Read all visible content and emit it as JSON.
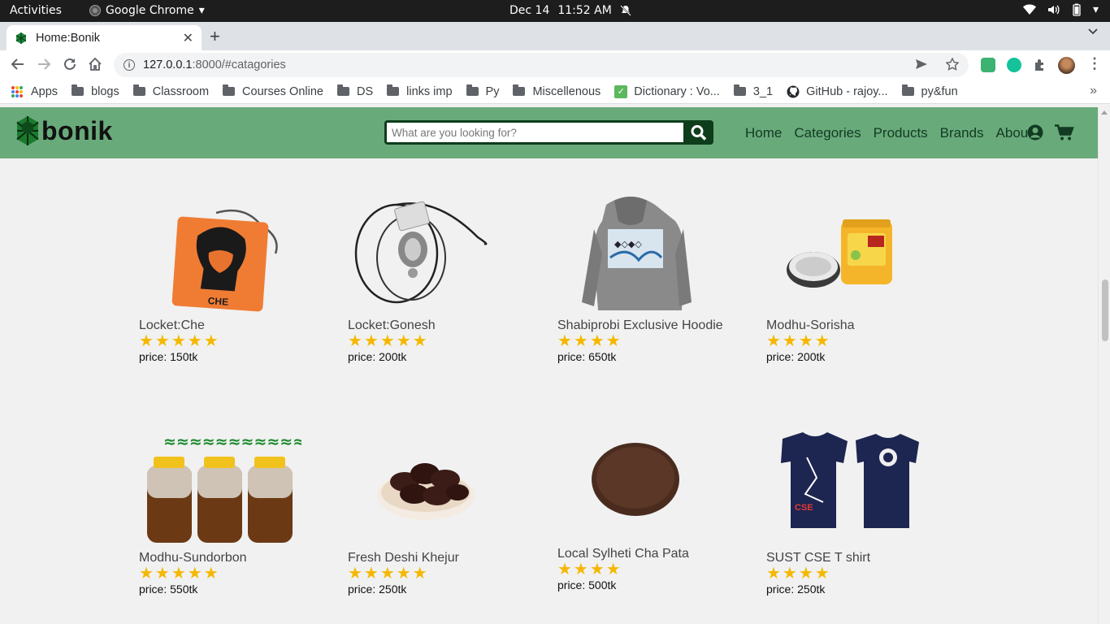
{
  "os_bar": {
    "activities": "Activities",
    "app_name": "Google Chrome",
    "date": "Dec 14",
    "time": "11:52 AM"
  },
  "tab": {
    "title": "Home:Bonik"
  },
  "address": {
    "host": "127.0.0.1",
    "rest": ":8000/#catagories"
  },
  "bookmarks": [
    {
      "label": "Apps",
      "icon": "apps-grid-icon"
    },
    {
      "label": "blogs",
      "icon": "folder-icon"
    },
    {
      "label": "Classroom",
      "icon": "folder-icon"
    },
    {
      "label": "Courses Online",
      "icon": "folder-icon"
    },
    {
      "label": "DS",
      "icon": "folder-icon"
    },
    {
      "label": "links imp",
      "icon": "folder-icon"
    },
    {
      "label": "Py",
      "icon": "folder-icon"
    },
    {
      "label": "Miscellenous",
      "icon": "folder-icon"
    },
    {
      "label": "Dictionary : Vo...",
      "icon": "check-icon"
    },
    {
      "label": "3_1",
      "icon": "folder-icon"
    },
    {
      "label": "GitHub - rajoy...",
      "icon": "github-icon"
    },
    {
      "label": "py&fun",
      "icon": "folder-icon"
    }
  ],
  "site": {
    "logo_text": "bonik",
    "search_placeholder": "What are you looking for?",
    "nav": [
      "Home",
      "Categories",
      "Products",
      "Brands",
      "About"
    ],
    "brand_color": "#69aa7b",
    "star_color": "#f5b800"
  },
  "products": [
    {
      "name": "Locket:Che",
      "rating": 5,
      "price": "price: 150tk"
    },
    {
      "name": "Locket:Gonesh",
      "rating": 5,
      "price": "price: 200tk"
    },
    {
      "name": "Shabiprobi Exclusive Hoodie",
      "rating": 4,
      "price": "price: 650tk"
    },
    {
      "name": "Modhu-Sorisha",
      "rating": 4,
      "price": "price: 200tk"
    },
    {
      "name": "Modhu-Sundorbon",
      "rating": 5,
      "price": "price: 550tk"
    },
    {
      "name": "Fresh Deshi Khejur",
      "rating": 5,
      "price": "price: 250tk"
    },
    {
      "name": "Local Sylheti Cha Pata",
      "rating": 4,
      "price": "price: 500tk"
    },
    {
      "name": "SUST CSE T shirt",
      "rating": 4,
      "price": "price: 250tk"
    }
  ]
}
